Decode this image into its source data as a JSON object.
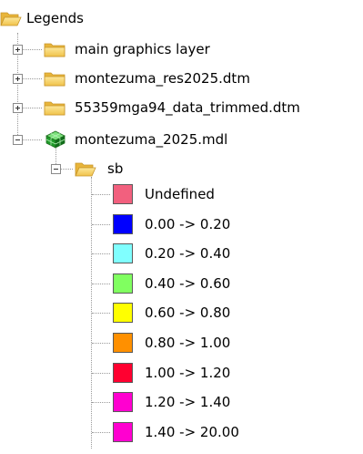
{
  "tree": {
    "root": {
      "label": "Legends",
      "icon": "folder-open-icon"
    },
    "layers": [
      {
        "label": "main graphics layer",
        "icon": "folder-icon",
        "expander": "plus"
      },
      {
        "label": "montezuma_res2025.dtm",
        "icon": "folder-icon",
        "expander": "plus"
      },
      {
        "label": "55359mga94_data_trimmed.dtm",
        "icon": "folder-icon",
        "expander": "plus"
      },
      {
        "label": "montezuma_2025.mdl",
        "icon": "block-model-icon",
        "expander": "minus"
      }
    ],
    "group": {
      "label": "sb",
      "icon": "folder-open-icon",
      "expander": "minus"
    },
    "legend_items": [
      {
        "label": "Undefined",
        "color": "#f2607e"
      },
      {
        "label": "0.00 -> 0.20",
        "color": "#0000ff"
      },
      {
        "label": "0.20 -> 0.40",
        "color": "#80ffff"
      },
      {
        "label": "0.40 -> 0.60",
        "color": "#80ff60"
      },
      {
        "label": "0.60 -> 0.80",
        "color": "#ffff00"
      },
      {
        "label": "0.80 -> 1.00",
        "color": "#ff9000"
      },
      {
        "label": "1.00 -> 1.20",
        "color": "#ff0030"
      },
      {
        "label": "1.20 -> 1.40",
        "color": "#ff00d0"
      },
      {
        "label": "1.40 -> 20.00",
        "color": "#ff00d0"
      }
    ]
  }
}
